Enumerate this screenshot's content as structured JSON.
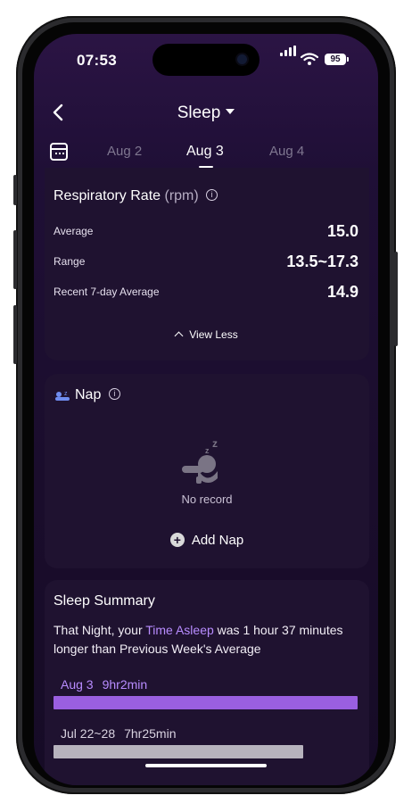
{
  "status_bar": {
    "time": "07:53",
    "battery": "95"
  },
  "nav": {
    "title": "Sleep"
  },
  "dates": {
    "prev": "Aug 2",
    "current": "Aug 3",
    "next": "Aug 4"
  },
  "respiratory": {
    "title": "Respiratory Rate",
    "unit": "(rpm)",
    "rows": [
      {
        "label": "Average",
        "value": "15.0"
      },
      {
        "label": "Range",
        "value": "13.5~17.3"
      },
      {
        "label": "Recent 7-day Average",
        "value": "14.9"
      }
    ],
    "toggle_label": "View Less"
  },
  "nap": {
    "title": "Nap",
    "empty_text": "No record",
    "add_label": "Add Nap"
  },
  "summary": {
    "title": "Sleep Summary",
    "text_before": "That Night, your ",
    "highlight": "Time Asleep",
    "text_after": " was 1  hour  37 minutes  longer than Previous Week's Average",
    "bars": [
      {
        "label": "Aug 3",
        "value_text": "9hr2min",
        "minutes": 542,
        "color": "#9a5fe0"
      },
      {
        "label": "Jul 22~28",
        "value_text": "7hr25min",
        "minutes": 445,
        "color": "#b7b3bd"
      }
    ]
  },
  "colors": {
    "accent": "#9a5fe0",
    "highlight": "#b88cff",
    "card": "#1f1230"
  }
}
